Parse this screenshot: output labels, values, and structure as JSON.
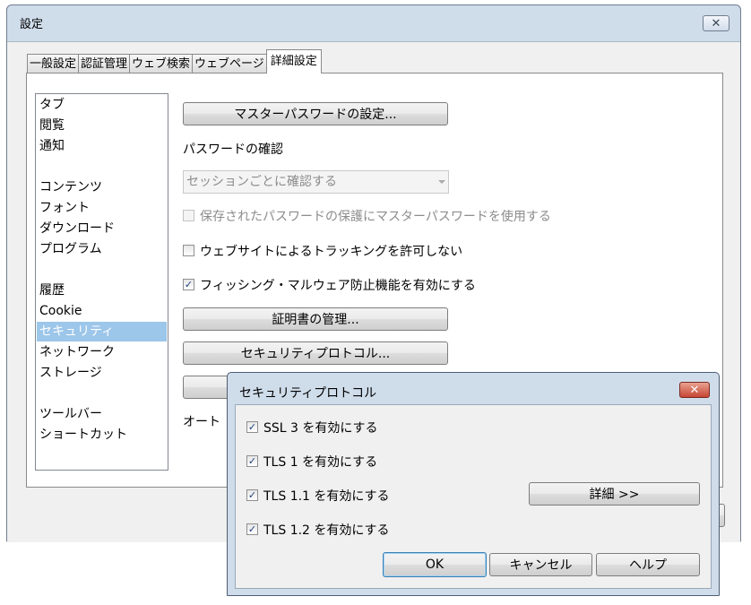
{
  "window": {
    "title": "設定",
    "close_glyph": "✕"
  },
  "tabs": [
    {
      "label": "一般設定",
      "active": false
    },
    {
      "label": "認証管理",
      "active": false
    },
    {
      "label": "ウェブ検索",
      "active": false
    },
    {
      "label": "ウェブページ",
      "active": false
    },
    {
      "label": "詳細設定",
      "active": true
    }
  ],
  "categories": [
    {
      "label": "タブ",
      "selected": false
    },
    {
      "label": "閲覧",
      "selected": false
    },
    {
      "label": "通知",
      "selected": false
    },
    {
      "label": "コンテンツ",
      "selected": false
    },
    {
      "label": "フォント",
      "selected": false
    },
    {
      "label": "ダウンロード",
      "selected": false
    },
    {
      "label": "プログラム",
      "selected": false
    },
    {
      "label": "履歴",
      "selected": false
    },
    {
      "label": "Cookie",
      "selected": false
    },
    {
      "label": "セキュリティ",
      "selected": true
    },
    {
      "label": "ネットワーク",
      "selected": false
    },
    {
      "label": "ストレージ",
      "selected": false
    },
    {
      "label": "ツールバー",
      "selected": false
    },
    {
      "label": "ショートカット",
      "selected": false
    }
  ],
  "security": {
    "master_password_button": "マスターパスワードの設定...",
    "password_confirm_label": "パスワードの確認",
    "password_confirm_select": "セッションごとに確認する",
    "use_master_password": {
      "label": "保存されたパスワードの保護にマスターパスワードを使用する",
      "checked": false,
      "enabled": false
    },
    "no_tracking": {
      "label": "ウェブサイトによるトラッキングを許可しない",
      "checked": false,
      "enabled": true
    },
    "phishing": {
      "label": "フィッシング・マルウェア防止機能を有効にする",
      "checked": true,
      "enabled": true
    },
    "certificates_button": "証明書の管理...",
    "protocols_button": "セキュリティプロトコル...",
    "partial_label": "オート"
  },
  "dialog": {
    "title": "セキュリティプロトコル",
    "close_glyph": "✕",
    "options": [
      {
        "label": "SSL 3 を有効にする",
        "checked": true
      },
      {
        "label": "TLS 1 を有効にする",
        "checked": true
      },
      {
        "label": "TLS 1.1 を有効にする",
        "checked": true
      },
      {
        "label": "TLS 1.2 を有効にする",
        "checked": true
      }
    ],
    "details_button": "詳細 >>",
    "ok_button": "OK",
    "cancel_button": "キャンセル",
    "help_button": "ヘルプ"
  },
  "colors": {
    "selection": "#9cc6ea",
    "frame": "#cfdcea",
    "close_red": "#c74534"
  }
}
